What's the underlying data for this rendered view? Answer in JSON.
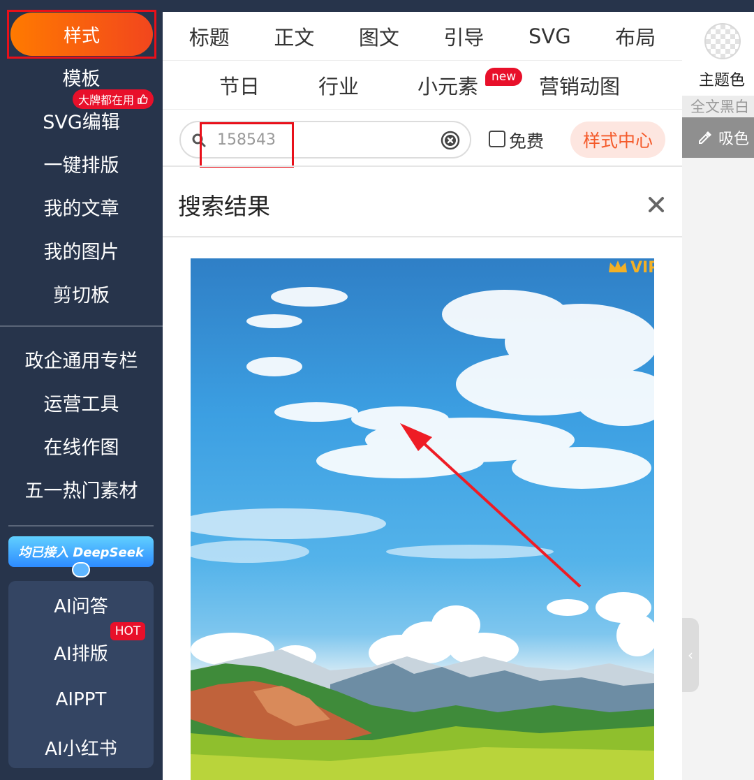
{
  "sidebar": {
    "active_item": "样式",
    "items": [
      "模板",
      "SVG编辑",
      "一键排版",
      "我的文章",
      "我的图片",
      "剪切板"
    ],
    "template_badge": "大牌都在用",
    "section2": [
      "政企通用专栏",
      "运营工具",
      "在线作图",
      "五一热门素材"
    ],
    "deepseek_banner": "均已接入 DeepSeek",
    "ai_items": [
      "AI问答",
      "AI排版",
      "AIPPT",
      "AI小红书"
    ],
    "hot_badge": "HOT"
  },
  "tabs": {
    "row1": [
      "标题",
      "正文",
      "图文",
      "引导",
      "SVG",
      "布局"
    ],
    "row2": [
      "节日",
      "行业",
      "小元素",
      "营销动图"
    ],
    "new_badge": "new"
  },
  "search": {
    "value": "158543",
    "free_label": "免费",
    "style_center": "样式中心"
  },
  "results": {
    "title": "搜索结果",
    "vip_label": "VIP"
  },
  "right_panel": {
    "theme_color_label": "主题色",
    "full_bw_label": "全文黑白",
    "picker_label": "吸色",
    "collapse_glyph": "‹"
  },
  "colors": {
    "sidebar_bg": "#27344b",
    "accent_orange": "#ff7a00",
    "accent_red": "#e8102a",
    "highlight_outline": "#e8101a"
  }
}
